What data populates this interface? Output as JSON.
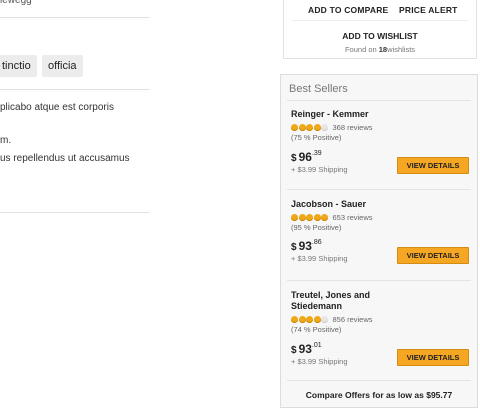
{
  "left": {
    "top_text": "iewegg",
    "tags": [
      "tinctio",
      "officia"
    ],
    "description_lines": [
      "plicabo atque est corporis",
      "m.",
      "us repellendus ut accusamus"
    ]
  },
  "actions": {
    "add_to_compare": "ADD TO COMPARE",
    "price_alert": "PRICE ALERT",
    "add_to_wishlist": "ADD TO WISHLIST",
    "found_prefix": "Found on",
    "found_count": "18",
    "found_suffix": "wishlists"
  },
  "best_sellers": {
    "title": "Best Sellers",
    "items": [
      {
        "name": "Reinger - Kemmer",
        "rating": 4,
        "reviews": "368 reviews",
        "positive": "(75 % Positive)",
        "price_dollar": "$",
        "price_whole": "96",
        "price_cents": ".39",
        "shipping": "+ $3.99 Shipping",
        "button": "VIEW DETAILS"
      },
      {
        "name": "Jacobson - Sauer",
        "rating": 5,
        "reviews": "653 reviews",
        "positive": "(95 % Positive)",
        "price_dollar": "$",
        "price_whole": "93",
        "price_cents": ".86",
        "shipping": "+ $3.99 Shipping",
        "button": "VIEW DETAILS"
      },
      {
        "name": "Treutel, Jones and Stiedemann",
        "rating": 4,
        "reviews": "856 reviews",
        "positive": "(74 % Positive)",
        "price_dollar": "$",
        "price_whole": "93",
        "price_cents": ".01",
        "shipping": "+ $3.99 Shipping",
        "button": "VIEW DETAILS"
      }
    ],
    "compare_text": "Compare Offers for as low as $95.77"
  },
  "colors": {
    "accent": "#f5a623",
    "star": "#f0a818"
  }
}
